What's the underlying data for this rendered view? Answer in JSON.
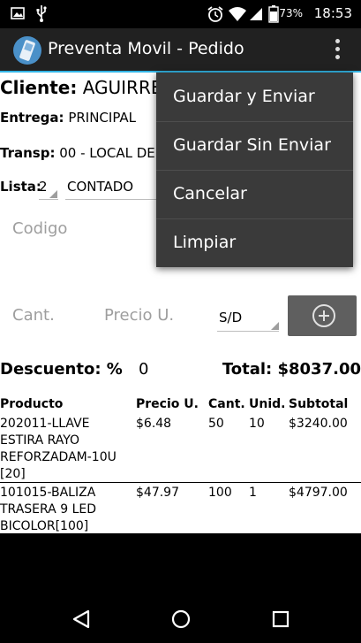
{
  "status_bar": {
    "battery_percent": "73%",
    "time": "18:53"
  },
  "action_bar": {
    "title": "Preventa Movil - Pedido"
  },
  "form": {
    "cliente_label": "Cliente:",
    "cliente_value": "AGUIRRE",
    "entrega_label": "Entrega:",
    "entrega_value": "PRINCIPAL",
    "transp_label": "Transp:",
    "transp_value": "00 - LOCAL DE V",
    "lista_label": "Lista:",
    "lista_number": "2",
    "lista_value": "CONTADO",
    "codigo_placeholder": "Codigo",
    "cant_placeholder": "Cant.",
    "precio_placeholder": "Precio U.",
    "sd_value": "S/D",
    "descuento_label": "Descuento: %",
    "descuento_value": "0",
    "total_label": "Total: $8037.00"
  },
  "table": {
    "headers": [
      "Producto",
      "Precio U.",
      "Cant.",
      "Unid.",
      "Subtotal"
    ],
    "rows": [
      {
        "producto": [
          "202011-LLAVE",
          "ESTIRA RAYO",
          "REFORZADAM-10U",
          "[20]"
        ],
        "precio": "$6.48",
        "cant": "50",
        "unid": "10",
        "subtotal": "$3240.00"
      },
      {
        "producto": [
          "101015-BALIZA",
          "TRASERA 9 LED",
          "BICOLOR[100]"
        ],
        "precio": "$47.97",
        "cant": "100",
        "unid": "1",
        "subtotal": "$4797.00"
      }
    ]
  },
  "menu": {
    "items": [
      "Guardar y Enviar",
      "Guardar Sin Enviar",
      "Cancelar",
      "Limpiar"
    ]
  },
  "icons": {
    "image": "image-icon",
    "usb": "usb-icon",
    "alarm": "alarm-icon",
    "wifi": "wifi-icon",
    "signal": "signal-icon",
    "battery": "battery-icon",
    "app": "app-icon",
    "overflow": "overflow-menu-icon",
    "add": "add-circle-icon",
    "back": "back-icon",
    "home": "home-icon",
    "recents": "recents-icon"
  }
}
